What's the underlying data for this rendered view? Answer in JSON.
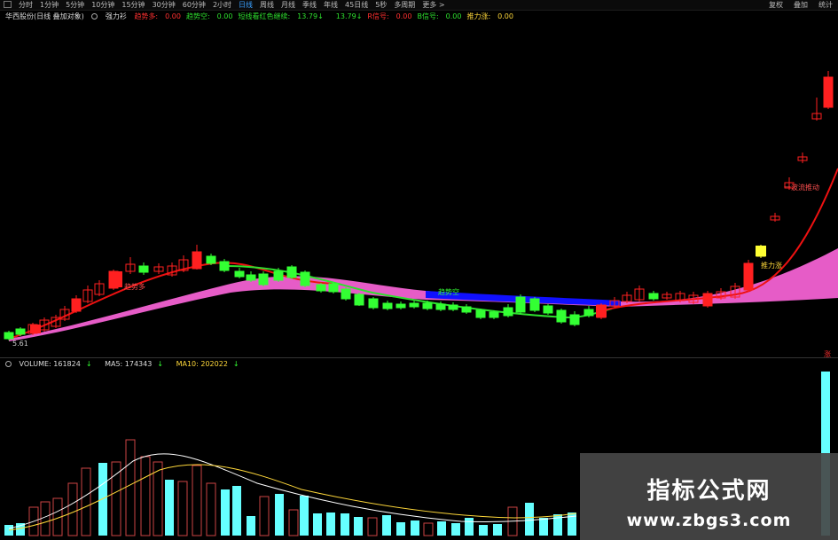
{
  "toolbar": {
    "periods": [
      "分时",
      "1分钟",
      "5分钟",
      "10分钟",
      "15分钟",
      "30分钟",
      "60分钟",
      "2小时",
      "日线",
      "周线",
      "月线",
      "季线",
      "年线",
      "45日线",
      "5秒",
      "多周期"
    ],
    "active_period": "日线",
    "more": "更多 >",
    "right": [
      "复权",
      "叠加",
      "统计"
    ]
  },
  "indicator": {
    "name": "华西股份(日线 叠加对象)",
    "formula": "强力衫",
    "items": [
      {
        "label": "趋势多:",
        "value": "0.00",
        "color": "#ff3030"
      },
      {
        "label": "趋势空:",
        "value": "0.00",
        "color": "#2ee02e"
      },
      {
        "label": "短线看红色继续:",
        "value": "13.79",
        "arrow": "↓",
        "color": "#2ee02e"
      },
      {
        "label": "",
        "value": "13.79",
        "arrow": "↓",
        "color": "#2ee02e"
      },
      {
        "label": "R信号:",
        "value": "0.00",
        "color": "#ff3030"
      },
      {
        "label": "B信号:",
        "value": "0.00",
        "color": "#2ee02e"
      },
      {
        "label": "推力涨:",
        "value": "0.00",
        "color": "#ffd83a"
      }
    ]
  },
  "volume": {
    "label": "VOLUME: 161824",
    "arrow1": "↓",
    "ma5": "MA5: 174343",
    "arrow2": "↓",
    "ma10": "MA10: 202022",
    "arrow3": "↓"
  },
  "annotations": {
    "left_low": "5.61",
    "trend_up": "趋势多",
    "trend_down": "趋势空",
    "push_up": "推力涨",
    "right_label": "一波流推动",
    "red_pct": "涨"
  },
  "watermark": {
    "title": "指标公式网",
    "url": "www.zbgs3.com"
  },
  "colors": {
    "up": "#ff2020",
    "down": "#33ff33",
    "pink_band": "#ff66dd",
    "blue_band": "#1010ff",
    "ma_red": "#e11",
    "vol_cyan": "#66ffff",
    "vol_red_outline": "#c44"
  },
  "candles": [
    [
      10,
      375,
      382,
      373,
      384,
      "g"
    ],
    [
      23,
      371,
      377,
      369,
      379,
      "g"
    ],
    [
      37,
      366,
      376,
      364,
      378,
      "r"
    ],
    [
      50,
      361,
      372,
      358,
      374,
      "r"
    ],
    [
      63,
      358,
      368,
      355,
      370,
      "r"
    ],
    [
      73,
      349,
      360,
      345,
      362,
      "r"
    ],
    [
      86,
      337,
      351,
      333,
      353,
      "r"
    ],
    [
      99,
      327,
      340,
      322,
      342,
      "r"
    ],
    [
      112,
      320,
      332,
      316,
      334,
      "r"
    ],
    [
      128,
      306,
      325,
      304,
      327,
      "r"
    ],
    [
      147,
      298,
      306,
      290,
      309,
      "r"
    ],
    [
      162,
      300,
      307,
      296,
      310,
      "g"
    ],
    [
      179,
      301,
      306,
      297,
      309,
      "r"
    ],
    [
      194,
      300,
      310,
      296,
      312,
      "r"
    ],
    [
      207,
      293,
      305,
      288,
      307,
      "r"
    ],
    [
      222,
      284,
      303,
      276,
      304,
      "r"
    ],
    [
      238,
      289,
      297,
      286,
      299,
      "g"
    ],
    [
      253,
      295,
      305,
      292,
      307,
      "g"
    ],
    [
      270,
      306,
      312,
      302,
      314,
      "g"
    ],
    [
      283,
      310,
      316,
      306,
      318,
      "g"
    ],
    [
      297,
      309,
      321,
      306,
      323,
      "g"
    ],
    [
      314,
      306,
      316,
      302,
      318,
      "g"
    ],
    [
      329,
      301,
      313,
      299,
      315,
      "g"
    ],
    [
      344,
      307,
      322,
      305,
      324,
      "g"
    ],
    [
      362,
      321,
      328,
      319,
      330,
      "g"
    ],
    [
      376,
      320,
      329,
      318,
      331,
      "g"
    ],
    [
      390,
      326,
      337,
      324,
      339,
      "g"
    ],
    [
      405,
      332,
      344,
      330,
      345,
      "g"
    ],
    [
      421,
      337,
      347,
      335,
      349,
      "g"
    ],
    [
      437,
      342,
      348,
      339,
      350,
      "g"
    ],
    [
      452,
      343,
      347,
      340,
      349,
      "g"
    ],
    [
      467,
      342,
      346,
      339,
      348,
      "g"
    ],
    [
      482,
      342,
      348,
      339,
      350,
      "g"
    ],
    [
      497,
      343,
      349,
      340,
      351,
      "g"
    ],
    [
      511,
      344,
      349,
      341,
      351,
      "g"
    ],
    [
      526,
      346,
      352,
      343,
      354,
      "g"
    ],
    [
      542,
      350,
      358,
      348,
      360,
      "g"
    ],
    [
      557,
      352,
      358,
      350,
      360,
      "g"
    ],
    [
      573,
      347,
      356,
      343,
      358,
      "g"
    ],
    [
      587,
      335,
      352,
      332,
      354,
      "g"
    ],
    [
      603,
      337,
      350,
      335,
      352,
      "g"
    ],
    [
      618,
      345,
      353,
      343,
      355,
      "g"
    ],
    [
      633,
      350,
      363,
      348,
      365,
      "g"
    ],
    [
      648,
      355,
      366,
      351,
      368,
      "g"
    ],
    [
      664,
      349,
      356,
      345,
      358,
      "g"
    ],
    [
      678,
      344,
      358,
      342,
      360,
      "r"
    ],
    [
      693,
      339,
      345,
      335,
      347,
      "r"
    ],
    [
      707,
      333,
      340,
      329,
      342,
      "r"
    ],
    [
      721,
      326,
      338,
      322,
      340,
      "r"
    ],
    [
      737,
      331,
      337,
      328,
      339,
      "g"
    ],
    [
      752,
      332,
      336,
      329,
      338,
      "r"
    ],
    [
      767,
      331,
      339,
      328,
      341,
      "r"
    ],
    [
      782,
      333,
      341,
      329,
      343,
      "r"
    ],
    [
      798,
      331,
      345,
      328,
      347,
      "r"
    ],
    [
      813,
      329,
      336,
      325,
      338,
      "r"
    ],
    [
      829,
      323,
      335,
      319,
      337,
      "r"
    ],
    [
      844,
      297,
      327,
      293,
      329,
      "r"
    ],
    [
      858,
      279,
      289,
      276,
      291,
      "y"
    ],
    [
      874,
      244,
      248,
      240,
      250,
      "r"
    ],
    [
      890,
      206,
      212,
      200,
      214,
      "r"
    ],
    [
      905,
      177,
      181,
      172,
      184,
      "r"
    ],
    [
      921,
      128,
      134,
      110,
      136,
      "r"
    ],
    [
      934,
      87,
      121,
      80,
      123,
      "r"
    ]
  ],
  "vol_bars": [
    [
      10,
      592,
      "c"
    ],
    [
      23,
      590,
      "c"
    ],
    [
      38,
      572,
      "r"
    ],
    [
      51,
      566,
      "r"
    ],
    [
      65,
      562,
      "r"
    ],
    [
      82,
      545,
      "r"
    ],
    [
      97,
      528,
      "r"
    ],
    [
      116,
      522,
      "c"
    ],
    [
      131,
      521,
      "r"
    ],
    [
      147,
      496,
      "r"
    ],
    [
      164,
      515,
      "r"
    ],
    [
      178,
      521,
      "r"
    ],
    [
      191,
      541,
      "c"
    ],
    [
      206,
      543,
      "r"
    ],
    [
      222,
      525,
      "r"
    ],
    [
      238,
      545,
      "r"
    ],
    [
      254,
      552,
      "c"
    ],
    [
      267,
      548,
      "c"
    ],
    [
      283,
      582,
      "c"
    ],
    [
      298,
      560,
      "r"
    ],
    [
      315,
      557,
      "c"
    ],
    [
      331,
      575,
      "r"
    ],
    [
      343,
      559,
      "c"
    ],
    [
      358,
      579,
      "c"
    ],
    [
      373,
      578,
      "c"
    ],
    [
      389,
      579,
      "c"
    ],
    [
      404,
      583,
      "c"
    ],
    [
      420,
      584,
      "r"
    ],
    [
      436,
      581,
      "c"
    ],
    [
      452,
      589,
      "c"
    ],
    [
      468,
      587,
      "c"
    ],
    [
      483,
      590,
      "r"
    ],
    [
      498,
      588,
      "c"
    ],
    [
      514,
      590,
      "c"
    ],
    [
      529,
      584,
      "c"
    ],
    [
      545,
      592,
      "c"
    ],
    [
      561,
      591,
      "c"
    ],
    [
      578,
      572,
      "r"
    ],
    [
      597,
      567,
      "c"
    ],
    [
      613,
      584,
      "c"
    ],
    [
      629,
      580,
      "c"
    ],
    [
      645,
      578,
      "c"
    ],
    [
      931,
      419,
      "c"
    ]
  ]
}
